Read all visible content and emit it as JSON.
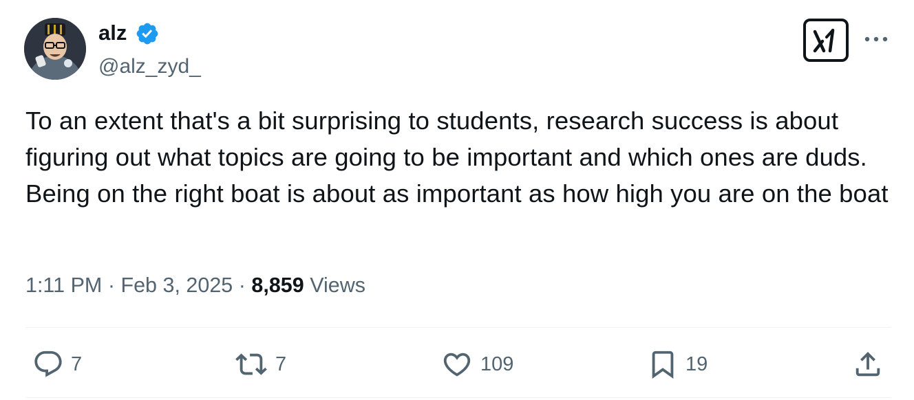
{
  "author": {
    "name": "alz",
    "handle": "@alz_zyd_",
    "verified": true,
    "verified_color": "#1d9bf0"
  },
  "tweet": {
    "text": "To an extent that's a bit surprising to students, research success is about figuring out what topics are going to be important and which ones are duds. Being on the right boat is about as important as how high you are on the boat"
  },
  "meta": {
    "time": "1:11 PM",
    "separator": "·",
    "date": "Feb 3, 2025",
    "views_count": "8,859",
    "views_label": "Views"
  },
  "actions": {
    "reply_count": "7",
    "retweet_count": "7",
    "like_count": "109",
    "bookmark_count": "19"
  },
  "icons": {
    "top_right": [
      "grok-icon",
      "more-icon"
    ],
    "actions": [
      "reply-icon",
      "retweet-icon",
      "like-icon",
      "bookmark-icon",
      "share-icon"
    ]
  },
  "colors": {
    "text": "#0f1419",
    "secondary": "#536471",
    "divider": "#eff3f4",
    "accent": "#1d9bf0"
  }
}
